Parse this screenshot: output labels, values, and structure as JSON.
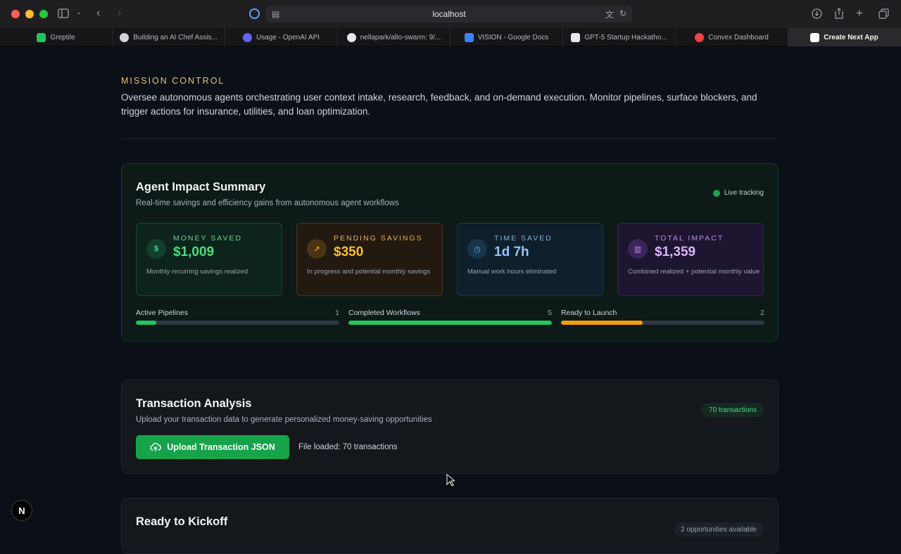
{
  "browser": {
    "url": "localhost",
    "tabs": [
      {
        "label": "Greptile",
        "color": "#22c55e"
      },
      {
        "label": "Building an AI Chef Assis...",
        "color": "#d4d4d8"
      },
      {
        "label": "Usage - OpenAI API",
        "color": "#6366f1"
      },
      {
        "label": "nellapark/alto-swarm: 9/...",
        "color": "#e5e7eb"
      },
      {
        "label": "VISION - Google Docs",
        "color": "#3b82f6"
      },
      {
        "label": "GPT-5 Startup Hackatho...",
        "color": "#e5e7eb"
      },
      {
        "label": "Convex Dashboard",
        "color": "#ef4444"
      },
      {
        "label": "Create Next App",
        "color": "#ffffff"
      }
    ]
  },
  "mission": {
    "eyebrow": "MISSION CONTROL",
    "description": "Oversee autonomous agents orchestrating user context intake, research, feedback, and on-demand execution. Monitor pipelines, surface blockers, and trigger actions for insurance, utilities, and loan optimization."
  },
  "impact": {
    "title": "Agent Impact Summary",
    "subtitle": "Real-time savings and efficiency gains from autonomous agent workflows",
    "live_label": "Live tracking",
    "stats": [
      {
        "label": "MONEY SAVED",
        "value": "$1,009",
        "desc": "Monthly recurring savings realized",
        "icon": "dollar-icon",
        "glyph": "$"
      },
      {
        "label": "PENDING SAVINGS",
        "value": "$350",
        "desc": "In progress and potential monthly savings",
        "icon": "trending-up-icon",
        "glyph": "↗"
      },
      {
        "label": "TIME SAVED",
        "value": "1d 7h",
        "desc": "Manual work hours eliminated",
        "icon": "clock-icon",
        "glyph": "◷"
      },
      {
        "label": "TOTAL IMPACT",
        "value": "$1,359",
        "desc": "Combined realized + potential monthly value",
        "icon": "bar-chart-icon",
        "glyph": "▥"
      }
    ],
    "pipelines": [
      {
        "label": "Active Pipelines",
        "count": "1",
        "fraction": 0.1,
        "color": "#22c55e"
      },
      {
        "label": "Completed Workflows",
        "count": "5",
        "fraction": 1.0,
        "color": "#22c55e"
      },
      {
        "label": "Ready to Launch",
        "count": "2",
        "fraction": 0.4,
        "color": "#f59e0b"
      }
    ]
  },
  "transactions": {
    "title": "Transaction Analysis",
    "subtitle": "Upload your transaction data to generate personalized money-saving opportunities",
    "badge": "70 transactions",
    "upload_label": "Upload Transaction JSON",
    "file_status": "File loaded: 70 transactions"
  },
  "kickoff": {
    "title": "Ready to Kickoff",
    "badge": "2 opportunities available"
  },
  "next_badge": "N"
}
